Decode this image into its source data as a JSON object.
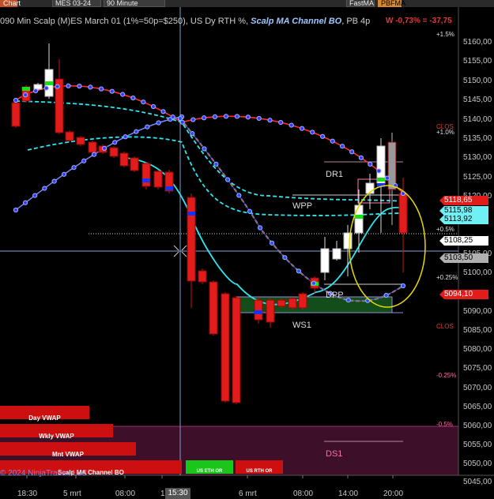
{
  "toolbar": {
    "chart_tab": "Chart",
    "instrument": "MES 03-24",
    "period": "90 Minute",
    "fast_ma": "FastMA",
    "pbfma": "PBFMA"
  },
  "title": {
    "prefix": "090 Min Scalp (M)ES March 01 (1%=50p=$250), US Dy RTH %,",
    "indicator": "Scalp MA Channel BO",
    "suffix": ", PB 4p"
  },
  "status": "W -0,73% = -37,75",
  "percent_labels": [
    {
      "text": "+1.5%",
      "tone": "up"
    },
    {
      "text": "CLOS",
      "tone": "red"
    },
    {
      "text": "+1.0%",
      "tone": "up"
    },
    {
      "text": "+0.5%",
      "tone": "up"
    },
    {
      "text": "+0.25%",
      "tone": "up"
    },
    {
      "text": "CLOS",
      "tone": "red"
    },
    {
      "text": "-0.25%",
      "tone": "dn"
    },
    {
      "text": "-0.5%",
      "tone": "dn"
    }
  ],
  "y_axis": [
    "5160,00",
    "5155,00",
    "5150,00",
    "5145,00",
    "5140,00",
    "5135,00",
    "5130,00",
    "5125,00",
    "5120,00",
    "5105,00",
    "5100,00",
    "5090,00",
    "5085,00",
    "5080,00",
    "5075,00",
    "5070,00",
    "5065,00",
    "5060,00",
    "5055,00",
    "5050,00",
    "5045,00"
  ],
  "price_tags": [
    {
      "text": "5118,65",
      "bg": "#e21b1b",
      "fg": "#ffffff"
    },
    {
      "text": "5115,98",
      "bg": "#6ff0f5",
      "fg": "#000000"
    },
    {
      "text": "5113,92",
      "bg": "#6ff0f5",
      "fg": "#000000"
    },
    {
      "text": "5108,25",
      "bg": "#ffffff",
      "fg": "#000000"
    },
    {
      "text": "5103,50",
      "bg": "#b0b0b0",
      "fg": "#000000"
    },
    {
      "text": "5094,10",
      "bg": "#e21b1b",
      "fg": "#ffffff"
    }
  ],
  "x_axis": [
    "18:30",
    "5 mrt",
    "08:00",
    "1",
    "6 mrt",
    "08:00",
    "14:00",
    "20:00"
  ],
  "cursor_time": "15:30",
  "levels": {
    "dr1": "DR1",
    "wpp": "WPP",
    "dpp": "DPP",
    "ws1": "WS1",
    "ds1": "DS1"
  },
  "vwap_bars": [
    {
      "text": "Day VWAP"
    },
    {
      "text": "Wkly VWAP"
    },
    {
      "text": "Mnt VWAP"
    },
    {
      "text": "Scalp MA Channel BO"
    },
    {
      "text": "US ETH OR"
    },
    {
      "text": "US RTH OR"
    }
  ],
  "copyright": "© 2024 NinjaTrader, LLC",
  "colors": {
    "bull": "#ffffff",
    "bear": "#e21b1b",
    "cyan": "#2ee6f0",
    "orange": "#ff9900",
    "ellipse": "#e8d800"
  }
}
